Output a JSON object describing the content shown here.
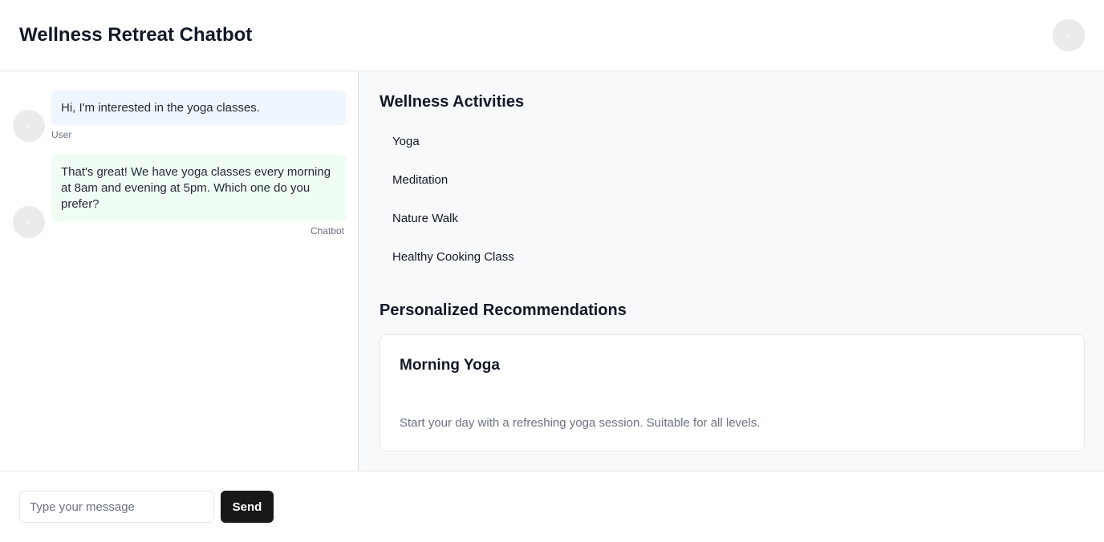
{
  "header": {
    "title": "Wellness Retreat Chatbot",
    "avatar_icon": "user-avatar-icon"
  },
  "chat": {
    "messages": [
      {
        "text": "Hi, I'm interested in the yoga classes.",
        "sender": "User",
        "role": "user"
      },
      {
        "text": "That's great! We have yoga classes every morning at 8am and evening at 5pm. Which one do you prefer?",
        "sender": "Chatbot",
        "role": "bot"
      }
    ]
  },
  "activities": {
    "title": "Wellness Activities",
    "items": [
      "Yoga",
      "Meditation",
      "Nature Walk",
      "Healthy Cooking Class"
    ]
  },
  "recommendations": {
    "title": "Personalized Recommendations",
    "cards": [
      {
        "title": "Morning Yoga",
        "description": "Start your day with a refreshing yoga session. Suitable for all levels."
      }
    ]
  },
  "composer": {
    "placeholder": "Type your message",
    "value": "",
    "send_label": "Send"
  },
  "colors": {
    "user_bubble": "#eff6ff",
    "bot_bubble": "#f0fdf4",
    "send_button": "#18181b",
    "side_panel": "#f8f9fa"
  }
}
